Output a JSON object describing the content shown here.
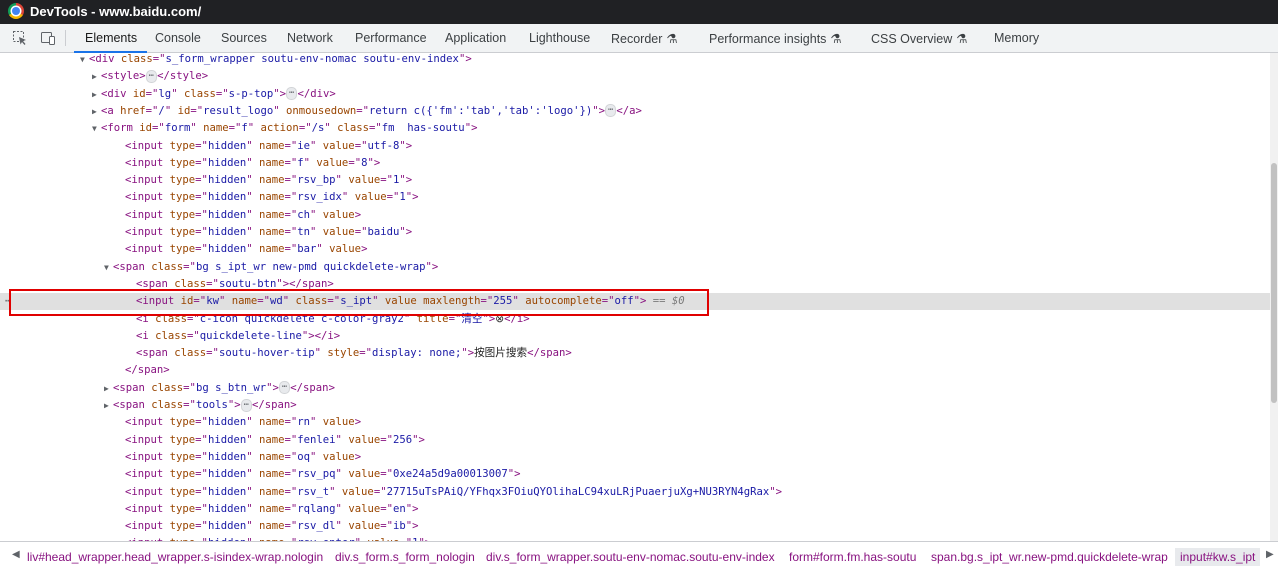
{
  "window": {
    "title": "DevTools - www.baidu.com/"
  },
  "tabs": [
    "Elements",
    "Console",
    "Sources",
    "Network",
    "Performance",
    "Application",
    "Lighthouse",
    "Recorder",
    "Performance insights",
    "CSS Overview",
    "Memory"
  ],
  "flask_icon": "⚗",
  "dom": [
    {
      "tri": "▼",
      "parts": [
        [
          "t",
          "<div "
        ],
        [
          "an",
          "class"
        ],
        [
          "t",
          "=\""
        ],
        [
          "av",
          "s_form_wrapper soutu-env-nomac soutu-env-index"
        ],
        [
          "t",
          "\">"
        ]
      ]
    },
    {
      "tri": "▶",
      "parts": [
        [
          "t",
          "<style>"
        ],
        [
          "ell",
          "⋯"
        ],
        [
          "t",
          "</style>"
        ]
      ]
    },
    {
      "tri": "▶",
      "parts": [
        [
          "t",
          "<div "
        ],
        [
          "an",
          "id"
        ],
        [
          "t",
          "=\""
        ],
        [
          "av",
          "lg"
        ],
        [
          "t",
          "\" "
        ],
        [
          "an",
          "class"
        ],
        [
          "t",
          "=\""
        ],
        [
          "av",
          "s-p-top"
        ],
        [
          "t",
          "\">"
        ],
        [
          "ell",
          "⋯"
        ],
        [
          "t",
          "</div>"
        ]
      ]
    },
    {
      "tri": "▶",
      "parts": [
        [
          "t",
          "<a "
        ],
        [
          "an",
          "href"
        ],
        [
          "t",
          "=\""
        ],
        [
          "av",
          "/"
        ],
        [
          "t",
          "\" "
        ],
        [
          "an",
          "id"
        ],
        [
          "t",
          "=\""
        ],
        [
          "av",
          "result_logo"
        ],
        [
          "t",
          "\" "
        ],
        [
          "an",
          "onmousedown"
        ],
        [
          "t",
          "=\""
        ],
        [
          "av",
          "return c({'fm':'tab','tab':'logo'})"
        ],
        [
          "t",
          "\">"
        ],
        [
          "ell",
          "⋯"
        ],
        [
          "t",
          "</a>"
        ]
      ]
    },
    {
      "tri": "▼",
      "parts": [
        [
          "t",
          "<form "
        ],
        [
          "an",
          "id"
        ],
        [
          "t",
          "=\""
        ],
        [
          "av",
          "form"
        ],
        [
          "t",
          "\" "
        ],
        [
          "an",
          "name"
        ],
        [
          "t",
          "=\""
        ],
        [
          "av",
          "f"
        ],
        [
          "t",
          "\" "
        ],
        [
          "an",
          "action"
        ],
        [
          "t",
          "=\""
        ],
        [
          "av",
          "/s"
        ],
        [
          "t",
          "\" "
        ],
        [
          "an",
          "class"
        ],
        [
          "t",
          "=\""
        ],
        [
          "av",
          "fm  has-soutu"
        ],
        [
          "t",
          "\">"
        ]
      ]
    },
    {
      "tri": "",
      "parts": [
        [
          "t",
          "<input "
        ],
        [
          "an",
          "type"
        ],
        [
          "t",
          "=\""
        ],
        [
          "av",
          "hidden"
        ],
        [
          "t",
          "\" "
        ],
        [
          "an",
          "name"
        ],
        [
          "t",
          "=\""
        ],
        [
          "av",
          "ie"
        ],
        [
          "t",
          "\" "
        ],
        [
          "an",
          "value"
        ],
        [
          "t",
          "=\""
        ],
        [
          "av",
          "utf-8"
        ],
        [
          "t",
          "\">"
        ]
      ]
    },
    {
      "tri": "",
      "parts": [
        [
          "t",
          "<input "
        ],
        [
          "an",
          "type"
        ],
        [
          "t",
          "=\""
        ],
        [
          "av",
          "hidden"
        ],
        [
          "t",
          "\" "
        ],
        [
          "an",
          "name"
        ],
        [
          "t",
          "=\""
        ],
        [
          "av",
          "f"
        ],
        [
          "t",
          "\" "
        ],
        [
          "an",
          "value"
        ],
        [
          "t",
          "=\""
        ],
        [
          "av",
          "8"
        ],
        [
          "t",
          "\">"
        ]
      ]
    },
    {
      "tri": "",
      "parts": [
        [
          "t",
          "<input "
        ],
        [
          "an",
          "type"
        ],
        [
          "t",
          "=\""
        ],
        [
          "av",
          "hidden"
        ],
        [
          "t",
          "\" "
        ],
        [
          "an",
          "name"
        ],
        [
          "t",
          "=\""
        ],
        [
          "av",
          "rsv_bp"
        ],
        [
          "t",
          "\" "
        ],
        [
          "an",
          "value"
        ],
        [
          "t",
          "=\""
        ],
        [
          "av",
          "1"
        ],
        [
          "t",
          "\">"
        ]
      ]
    },
    {
      "tri": "",
      "parts": [
        [
          "t",
          "<input "
        ],
        [
          "an",
          "type"
        ],
        [
          "t",
          "=\""
        ],
        [
          "av",
          "hidden"
        ],
        [
          "t",
          "\" "
        ],
        [
          "an",
          "name"
        ],
        [
          "t",
          "=\""
        ],
        [
          "av",
          "rsv_idx"
        ],
        [
          "t",
          "\" "
        ],
        [
          "an",
          "value"
        ],
        [
          "t",
          "=\""
        ],
        [
          "av",
          "1"
        ],
        [
          "t",
          "\">"
        ]
      ]
    },
    {
      "tri": "",
      "parts": [
        [
          "t",
          "<input "
        ],
        [
          "an",
          "type"
        ],
        [
          "t",
          "=\""
        ],
        [
          "av",
          "hidden"
        ],
        [
          "t",
          "\" "
        ],
        [
          "an",
          "name"
        ],
        [
          "t",
          "=\""
        ],
        [
          "av",
          "ch"
        ],
        [
          "t",
          "\" "
        ],
        [
          "an",
          "value"
        ],
        [
          "t",
          ">"
        ]
      ]
    },
    {
      "tri": "",
      "parts": [
        [
          "t",
          "<input "
        ],
        [
          "an",
          "type"
        ],
        [
          "t",
          "=\""
        ],
        [
          "av",
          "hidden"
        ],
        [
          "t",
          "\" "
        ],
        [
          "an",
          "name"
        ],
        [
          "t",
          "=\""
        ],
        [
          "av",
          "tn"
        ],
        [
          "t",
          "\" "
        ],
        [
          "an",
          "value"
        ],
        [
          "t",
          "=\""
        ],
        [
          "av",
          "baidu"
        ],
        [
          "t",
          "\">"
        ]
      ]
    },
    {
      "tri": "",
      "parts": [
        [
          "t",
          "<input "
        ],
        [
          "an",
          "type"
        ],
        [
          "t",
          "=\""
        ],
        [
          "av",
          "hidden"
        ],
        [
          "t",
          "\" "
        ],
        [
          "an",
          "name"
        ],
        [
          "t",
          "=\""
        ],
        [
          "av",
          "bar"
        ],
        [
          "t",
          "\" "
        ],
        [
          "an",
          "value"
        ],
        [
          "t",
          ">"
        ]
      ]
    },
    {
      "tri": "▼",
      "parts": [
        [
          "t",
          "<span "
        ],
        [
          "an",
          "class"
        ],
        [
          "t",
          "=\""
        ],
        [
          "av",
          "bg s_ipt_wr new-pmd quickdelete-wrap"
        ],
        [
          "t",
          "\">"
        ]
      ]
    },
    {
      "tri": "",
      "parts": [
        [
          "t",
          "<span "
        ],
        [
          "an",
          "class"
        ],
        [
          "t",
          "=\""
        ],
        [
          "av",
          "soutu-btn"
        ],
        [
          "t",
          "\"></span>"
        ]
      ]
    },
    {
      "tri": "",
      "parts": [
        [
          "t",
          "<input "
        ],
        [
          "an",
          "id"
        ],
        [
          "t",
          "=\""
        ],
        [
          "av",
          "kw"
        ],
        [
          "t",
          "\" "
        ],
        [
          "an",
          "name"
        ],
        [
          "t",
          "=\""
        ],
        [
          "av",
          "wd"
        ],
        [
          "t",
          "\" "
        ],
        [
          "an",
          "class"
        ],
        [
          "t",
          "=\""
        ],
        [
          "av",
          "s_ipt"
        ],
        [
          "t",
          "\" "
        ],
        [
          "an",
          "value"
        ],
        [
          "t",
          " "
        ],
        [
          "an",
          "maxlength"
        ],
        [
          "t",
          "=\""
        ],
        [
          "av",
          "255"
        ],
        [
          "t",
          "\" "
        ],
        [
          "an",
          "autocomplete"
        ],
        [
          "t",
          "=\""
        ],
        [
          "av",
          "off"
        ],
        [
          "t",
          "\">"
        ],
        [
          "dollar",
          " == $0"
        ]
      ]
    },
    {
      "tri": "",
      "parts": [
        [
          "t",
          "<i "
        ],
        [
          "an",
          "class"
        ],
        [
          "t",
          "=\""
        ],
        [
          "av",
          "c-icon quickdelete c-color-gray2"
        ],
        [
          "t",
          "\" "
        ],
        [
          "an",
          "title"
        ],
        [
          "t",
          "=\""
        ],
        [
          "av",
          "清空"
        ],
        [
          "t",
          "\">"
        ],
        [
          "txt",
          "⊗"
        ],
        [
          "t",
          "</i>"
        ]
      ]
    },
    {
      "tri": "",
      "parts": [
        [
          "t",
          "<i "
        ],
        [
          "an",
          "class"
        ],
        [
          "t",
          "=\""
        ],
        [
          "av",
          "quickdelete-line"
        ],
        [
          "t",
          "\"></i>"
        ]
      ]
    },
    {
      "tri": "",
      "parts": [
        [
          "t",
          "<span "
        ],
        [
          "an",
          "class"
        ],
        [
          "t",
          "=\""
        ],
        [
          "av",
          "soutu-hover-tip"
        ],
        [
          "t",
          "\" "
        ],
        [
          "an",
          "style"
        ],
        [
          "t",
          "=\""
        ],
        [
          "av",
          "display: none;"
        ],
        [
          "t",
          "\">"
        ],
        [
          "txt",
          "按图片搜索"
        ],
        [
          "t",
          "</span>"
        ]
      ]
    },
    {
      "tri": "",
      "parts": [
        [
          "t",
          "</span>"
        ]
      ]
    },
    {
      "tri": "▶",
      "parts": [
        [
          "t",
          "<span "
        ],
        [
          "an",
          "class"
        ],
        [
          "t",
          "=\""
        ],
        [
          "av",
          "bg s_btn_wr"
        ],
        [
          "t",
          "\">"
        ],
        [
          "ell",
          "⋯"
        ],
        [
          "t",
          "</span>"
        ]
      ]
    },
    {
      "tri": "▶",
      "parts": [
        [
          "t",
          "<span "
        ],
        [
          "an",
          "class"
        ],
        [
          "t",
          "=\""
        ],
        [
          "av",
          "tools"
        ],
        [
          "t",
          "\">"
        ],
        [
          "ell",
          "⋯"
        ],
        [
          "t",
          "</span>"
        ]
      ]
    },
    {
      "tri": "",
      "parts": [
        [
          "t",
          "<input "
        ],
        [
          "an",
          "type"
        ],
        [
          "t",
          "=\""
        ],
        [
          "av",
          "hidden"
        ],
        [
          "t",
          "\" "
        ],
        [
          "an",
          "name"
        ],
        [
          "t",
          "=\""
        ],
        [
          "av",
          "rn"
        ],
        [
          "t",
          "\" "
        ],
        [
          "an",
          "value"
        ],
        [
          "t",
          ">"
        ]
      ]
    },
    {
      "tri": "",
      "parts": [
        [
          "t",
          "<input "
        ],
        [
          "an",
          "type"
        ],
        [
          "t",
          "=\""
        ],
        [
          "av",
          "hidden"
        ],
        [
          "t",
          "\" "
        ],
        [
          "an",
          "name"
        ],
        [
          "t",
          "=\""
        ],
        [
          "av",
          "fenlei"
        ],
        [
          "t",
          "\" "
        ],
        [
          "an",
          "value"
        ],
        [
          "t",
          "=\""
        ],
        [
          "av",
          "256"
        ],
        [
          "t",
          "\">"
        ]
      ]
    },
    {
      "tri": "",
      "parts": [
        [
          "t",
          "<input "
        ],
        [
          "an",
          "type"
        ],
        [
          "t",
          "=\""
        ],
        [
          "av",
          "hidden"
        ],
        [
          "t",
          "\" "
        ],
        [
          "an",
          "name"
        ],
        [
          "t",
          "=\""
        ],
        [
          "av",
          "oq"
        ],
        [
          "t",
          "\" "
        ],
        [
          "an",
          "value"
        ],
        [
          "t",
          ">"
        ]
      ]
    },
    {
      "tri": "",
      "parts": [
        [
          "t",
          "<input "
        ],
        [
          "an",
          "type"
        ],
        [
          "t",
          "=\""
        ],
        [
          "av",
          "hidden"
        ],
        [
          "t",
          "\" "
        ],
        [
          "an",
          "name"
        ],
        [
          "t",
          "=\""
        ],
        [
          "av",
          "rsv_pq"
        ],
        [
          "t",
          "\" "
        ],
        [
          "an",
          "value"
        ],
        [
          "t",
          "=\""
        ],
        [
          "av",
          "0xe24a5d9a00013007"
        ],
        [
          "t",
          "\">"
        ]
      ]
    },
    {
      "tri": "",
      "parts": [
        [
          "t",
          "<input "
        ],
        [
          "an",
          "type"
        ],
        [
          "t",
          "=\""
        ],
        [
          "av",
          "hidden"
        ],
        [
          "t",
          "\" "
        ],
        [
          "an",
          "name"
        ],
        [
          "t",
          "=\""
        ],
        [
          "av",
          "rsv_t"
        ],
        [
          "t",
          "\" "
        ],
        [
          "an",
          "value"
        ],
        [
          "t",
          "=\""
        ],
        [
          "av",
          "27715uTsPAiQ/YFhqx3FOiuQYOlihaLC94xuLRjPuaerjuXg+NU3RYN4gRax"
        ],
        [
          "t",
          "\">"
        ]
      ]
    },
    {
      "tri": "",
      "parts": [
        [
          "t",
          "<input "
        ],
        [
          "an",
          "type"
        ],
        [
          "t",
          "=\""
        ],
        [
          "av",
          "hidden"
        ],
        [
          "t",
          "\" "
        ],
        [
          "an",
          "name"
        ],
        [
          "t",
          "=\""
        ],
        [
          "av",
          "rqlang"
        ],
        [
          "t",
          "\" "
        ],
        [
          "an",
          "value"
        ],
        [
          "t",
          "=\""
        ],
        [
          "av",
          "en"
        ],
        [
          "t",
          "\">"
        ]
      ]
    },
    {
      "tri": "",
      "parts": [
        [
          "t",
          "<input "
        ],
        [
          "an",
          "type"
        ],
        [
          "t",
          "=\""
        ],
        [
          "av",
          "hidden"
        ],
        [
          "t",
          "\" "
        ],
        [
          "an",
          "name"
        ],
        [
          "t",
          "=\""
        ],
        [
          "av",
          "rsv_dl"
        ],
        [
          "t",
          "\" "
        ],
        [
          "an",
          "value"
        ],
        [
          "t",
          "=\""
        ],
        [
          "av",
          "ib"
        ],
        [
          "t",
          "\">"
        ]
      ]
    },
    {
      "tri": "",
      "parts": [
        [
          "t",
          "<input "
        ],
        [
          "an",
          "type"
        ],
        [
          "t",
          "=\""
        ],
        [
          "av",
          "hidden"
        ],
        [
          "t",
          "\" "
        ],
        [
          "an",
          "name"
        ],
        [
          "t",
          "=\""
        ],
        [
          "av",
          "rsv_enter"
        ],
        [
          "t",
          "\" "
        ],
        [
          "an",
          "value"
        ],
        [
          "t",
          "=\""
        ],
        [
          "av",
          "1"
        ],
        [
          "t",
          "\">"
        ]
      ]
    }
  ],
  "selected_gutter": "⋯",
  "breadcrumbs": [
    "liv#head_wrapper.head_wrapper.s-isindex-wrap.nologin",
    "div.s_form.s_form_nologin",
    "div.s_form_wrapper.soutu-env-nomac.soutu-env-index",
    "form#form.fm.has-soutu",
    "span.bg.s_ipt_wr.new-pmd.quickdelete-wrap",
    "input#kw.s_ipt"
  ],
  "crumb_left": "◀",
  "crumb_right": "▶"
}
